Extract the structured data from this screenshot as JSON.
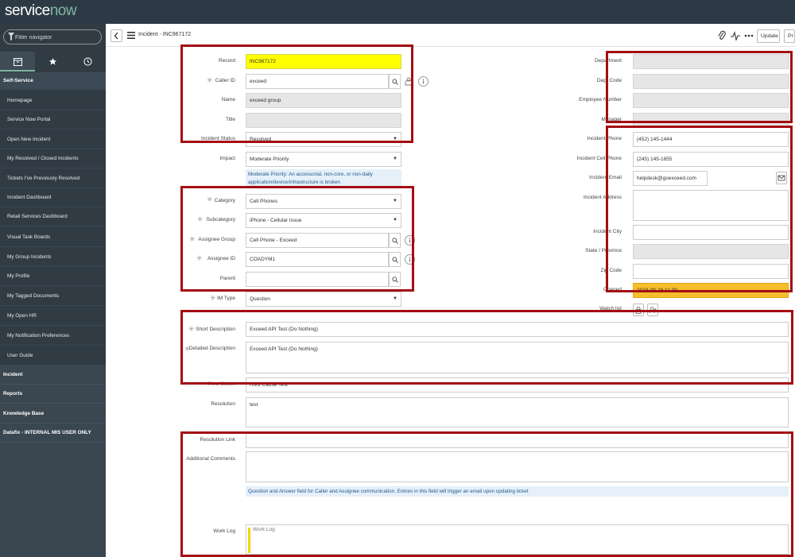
{
  "brand": {
    "text": "service",
    "dot": "now"
  },
  "nav": {
    "filter_placeholder": "Filter navigator",
    "section": "Self-Service",
    "modules": [
      "Homepage",
      "Service Now Portal",
      "Open New Incident",
      "My Resolved / Closed Incidents",
      "Tickets I've Previously Resolved",
      "Incident Dashboard",
      "Retail Services Dashboard",
      "Visual Task Boards",
      "My Group Incidents",
      "My Profile",
      "My Tagged Documents",
      "My Open HR",
      "My Notification Preferences",
      "User Guide"
    ],
    "apps": [
      "Incident",
      "Reports",
      "Knowledge Base",
      "Datafix - INTERNAL MIS USER ONLY"
    ]
  },
  "header": {
    "title": "Incident - INC967172",
    "update_label": "Update",
    "partial_btn_label": "Pr"
  },
  "form": {
    "record": {
      "label": "Record",
      "value": "INC967172"
    },
    "caller_id": {
      "label": "Caller ID",
      "value": "exceed"
    },
    "name": {
      "label": "Name",
      "value": "exceed group"
    },
    "title": {
      "label": "Title",
      "value": ""
    },
    "incident_status": {
      "label": "Incident Status",
      "value": "Resolved"
    },
    "impact": {
      "label": "Impact",
      "value": "Moderate Priority",
      "help": "Moderate Priority: An accessorial, non-core, or non-daily application/device/infrastructure is broken"
    },
    "category": {
      "label": "Category",
      "value": "Cell Phones"
    },
    "subcategory": {
      "label": "Subcategory",
      "value": "iPhone - Cellular Issue"
    },
    "assignee_group": {
      "label": "Assignee Group",
      "value": "Cell Phone - Exceed"
    },
    "assignee_id": {
      "label": "Assignee ID",
      "value": "COADYM1"
    },
    "parent": {
      "label": "Parent",
      "value": ""
    },
    "im_type": {
      "label": "IM Type",
      "value": "Question"
    },
    "department": {
      "label": "Department",
      "value": ""
    },
    "dept_code": {
      "label": "Dept Code",
      "value": ""
    },
    "employee_number": {
      "label": "Employee Number",
      "value": ""
    },
    "manager": {
      "label": "Manager",
      "value": ""
    },
    "incident_phone": {
      "label": "Incident Phone",
      "value": "(452) 145-1444"
    },
    "incident_cell_phone": {
      "label": "Incident Cell Phone",
      "value": "(245) 145-1855"
    },
    "incident_email": {
      "label": "Incident Email",
      "value": "helpdesk@goexceed.com"
    },
    "incident_address": {
      "label": "Incident Address",
      "value": ""
    },
    "incident_city": {
      "label": "Incident City",
      "value": ""
    },
    "state_province": {
      "label": "State / Province",
      "value": ""
    },
    "zip_code": {
      "label": "Zip Code",
      "value": ""
    },
    "opened": {
      "label": "Opened",
      "value": "2018-09-28 11:39"
    },
    "watch_list": {
      "label": "Watch list"
    },
    "short_description": {
      "label": "Short Description",
      "value": "Exceed API Test (Do Nothing)"
    },
    "detailed_description": {
      "label": "Detailed Description",
      "value": "Exceed API Test (Do Nothing)"
    },
    "root_cause": {
      "label": "Root Cause",
      "value": "Root Cause Test"
    },
    "resolution": {
      "label": "Resolution",
      "value": "test"
    },
    "resolution_link": {
      "label": "Resolution Link",
      "value": ""
    },
    "additional_comments": {
      "label": "Additional Comments",
      "value": "",
      "help": "Question and Answer field for Caller and Assignee communication. Entries in this field will trigger an email upon updating ticket"
    },
    "work_log": {
      "label": "Work Log",
      "placeholder": "Work Log"
    }
  },
  "colors": {
    "highlight_box": "#a40d12",
    "record_field": "#ffff00",
    "opened_field": "#f7be2b",
    "nav_bg": "#303b44",
    "banner_bg": "#2d3a45"
  }
}
